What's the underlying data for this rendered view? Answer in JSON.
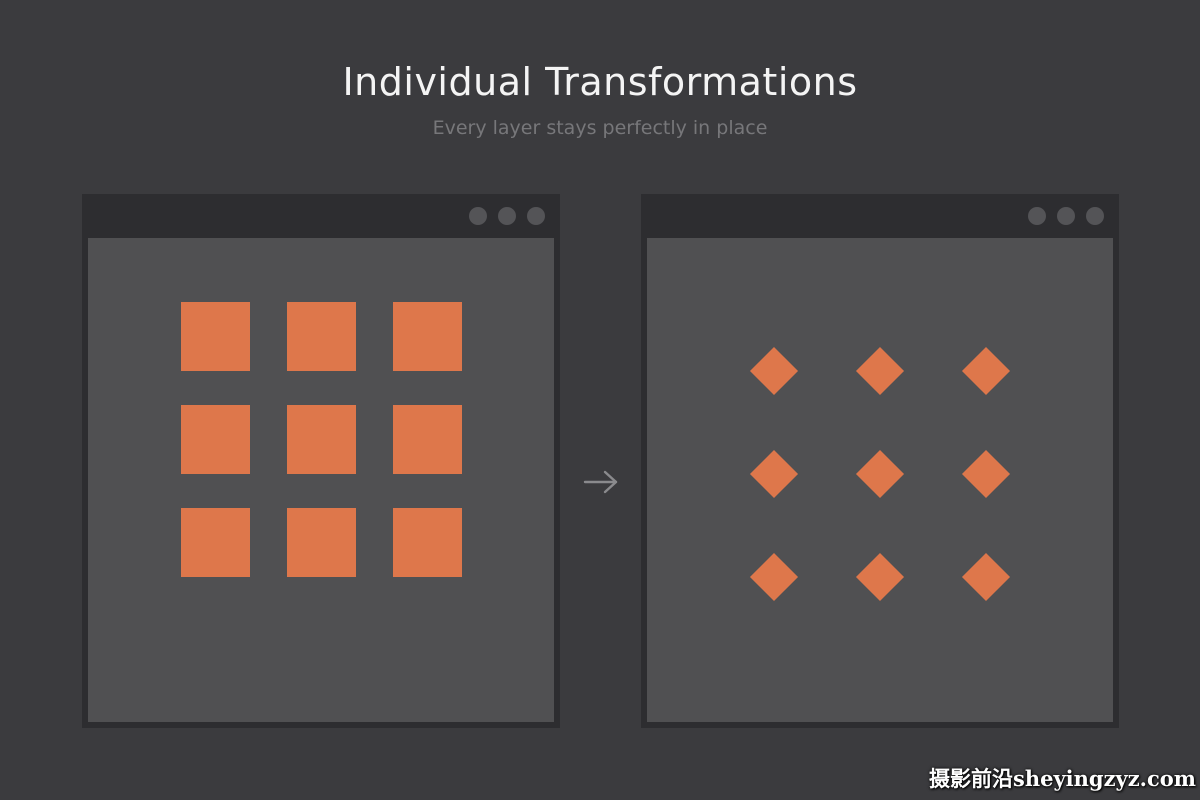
{
  "header": {
    "title": "Individual Transformations",
    "subtitle": "Every layer stays perfectly in place"
  },
  "colors": {
    "background": "#3b3b3e",
    "window_frame": "#2d2d30",
    "canvas": "#505052",
    "window_dot": "#545457",
    "shape": "#de774b",
    "arrow": "#8a8a8d"
  },
  "panels": [
    {
      "name": "before",
      "shape": "square",
      "rows": 3,
      "cols": 3,
      "rotation_deg": 0
    },
    {
      "name": "after",
      "shape": "square",
      "rows": 3,
      "cols": 3,
      "rotation_deg": 45
    }
  ],
  "connector": {
    "icon": "arrow-right-icon"
  },
  "watermark": {
    "text": "摄影前沿sheyingzyz.com"
  }
}
